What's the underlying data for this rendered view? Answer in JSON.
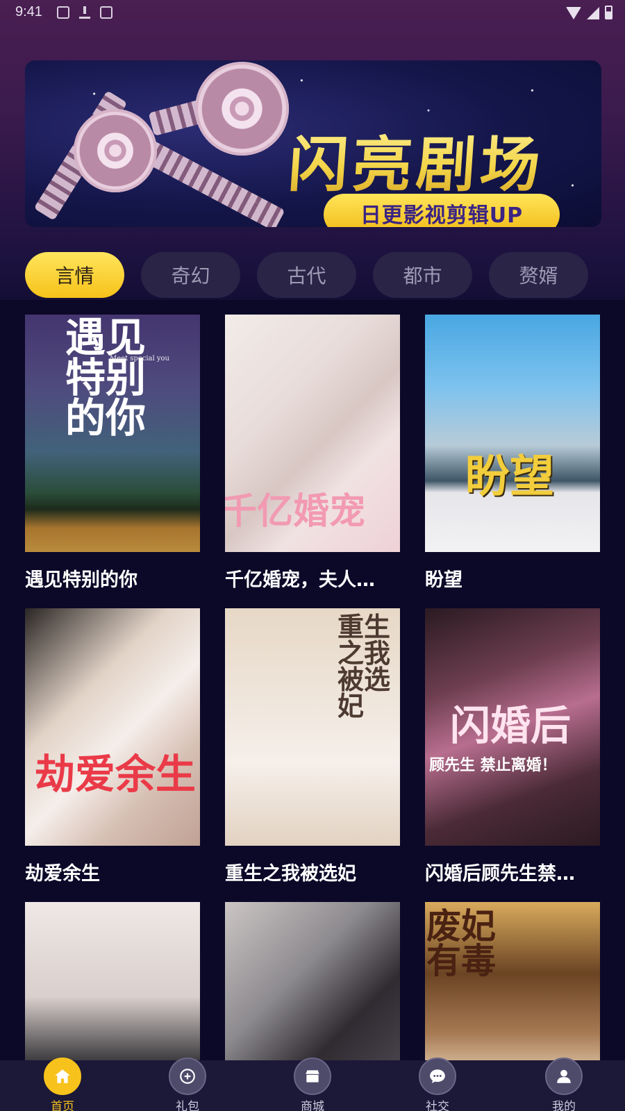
{
  "status_bar": {
    "time": "9:41"
  },
  "banner": {
    "title": "闪亮剧场",
    "subtitle": "日更影视剪辑UP"
  },
  "tabs": [
    {
      "label": "言情",
      "active": true
    },
    {
      "label": "奇幻",
      "active": false
    },
    {
      "label": "古代",
      "active": false
    },
    {
      "label": "都市",
      "active": false
    },
    {
      "label": "赘婿",
      "active": false
    }
  ],
  "dramas": [
    {
      "title": "遇见特别的你",
      "poster_text": "遇见特别的你",
      "poster_sub": "Meet special you"
    },
    {
      "title": "千亿婚宠，夫人…",
      "poster_text": "千亿婚宠"
    },
    {
      "title": "盼望",
      "poster_text": "盼望"
    },
    {
      "title": "劫爱余生",
      "poster_text": "劫爱余生"
    },
    {
      "title": "重生之我被选妃",
      "poster_text": "重生之我被选妃"
    },
    {
      "title": "闪婚后顾先生禁…",
      "poster_text": "闪婚后",
      "poster_sub": "顾先生 禁止离婚！"
    },
    {
      "title": "",
      "poster_text": ""
    },
    {
      "title": "",
      "poster_text": ""
    },
    {
      "title": "",
      "poster_text": "废妃有毒"
    }
  ],
  "bottom_nav": [
    {
      "label": "首页",
      "icon": "home-icon",
      "active": true
    },
    {
      "label": "礼包",
      "icon": "gift-icon",
      "active": false
    },
    {
      "label": "商城",
      "icon": "store-icon",
      "active": false
    },
    {
      "label": "社交",
      "icon": "chat-icon",
      "active": false
    },
    {
      "label": "我的",
      "icon": "profile-icon",
      "active": false
    }
  ],
  "colors": {
    "accent": "#f8c21c",
    "background": "#0b0828",
    "tab_inactive": "#2a2447"
  }
}
